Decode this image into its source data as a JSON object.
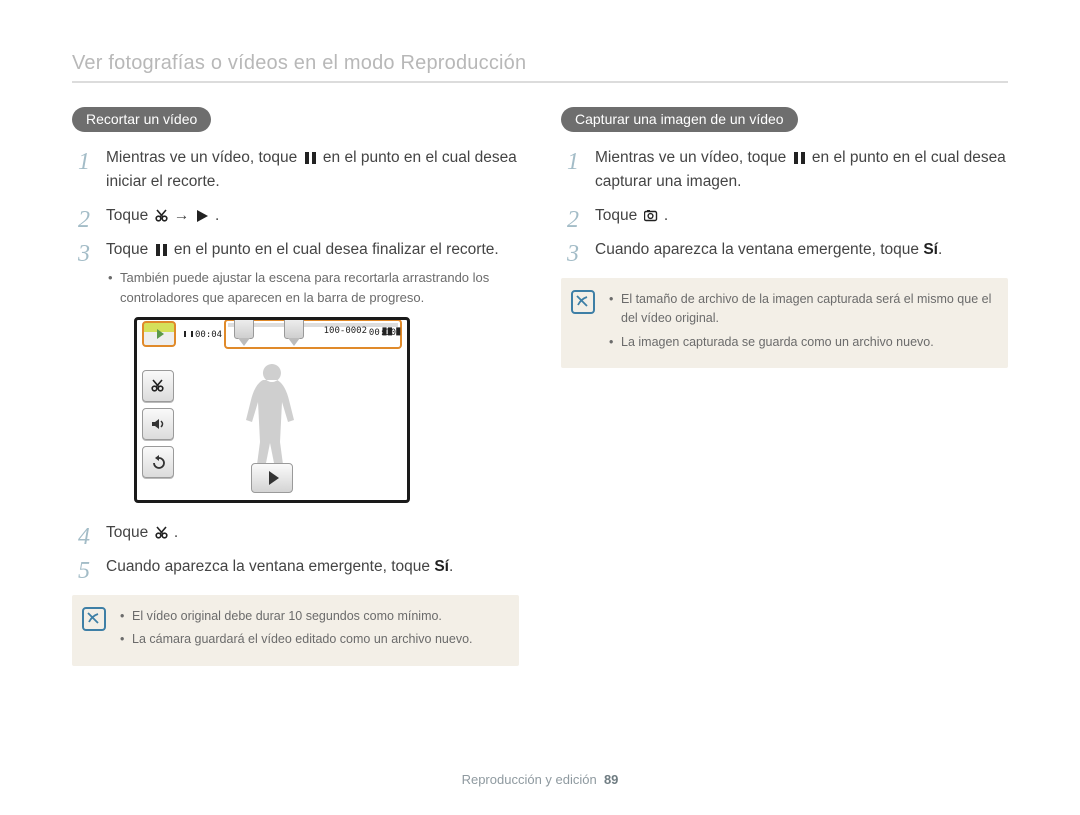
{
  "page_title": "Ver fotografías o vídeos en el modo Reproducción",
  "footer": {
    "section": "Reproducción y edición",
    "page": "89"
  },
  "left": {
    "heading": "Recortar un vídeo",
    "steps": [
      {
        "pre": "Mientras ve un vídeo, toque ",
        "icon": "pause",
        "post": " en el punto en el cual desea iniciar el recorte."
      },
      {
        "pre": "Toque ",
        "icon": "scissors",
        "mid": " → ",
        "icon2": "play",
        "post": "."
      },
      {
        "pre": "Toque ",
        "icon": "pause",
        "post": " en el punto en el cual desea finalizar el recorte.",
        "sub": "También puede ajustar la escena para recortarla arrastrando los controladores que aparecen en la barra de progreso."
      },
      {
        "pre": "Toque ",
        "icon": "scissors",
        "post": "."
      },
      {
        "pre": "Cuando aparezca la ventana emergente, toque ",
        "bold": "Sí",
        "post": "."
      }
    ],
    "note": [
      "El vídeo original debe durar 10 segundos como mínimo.",
      "La cámara guardará el vídeo editado como un archivo nuevo."
    ],
    "lcd": {
      "elapsed": "00:04",
      "total": "00:10",
      "file": "100-0002"
    }
  },
  "right": {
    "heading": "Capturar una imagen de un vídeo",
    "steps": [
      {
        "pre": "Mientras ve un vídeo, toque ",
        "icon": "pause",
        "post": " en el punto en el cual desea capturar una imagen."
      },
      {
        "pre": "Toque ",
        "icon": "capture",
        "post": "."
      },
      {
        "pre": "Cuando aparezca la ventana emergente, toque ",
        "bold": "Sí",
        "post": "."
      }
    ],
    "note": [
      "El tamaño de archivo de la imagen capturada será el mismo que el del vídeo original.",
      "La imagen capturada se guarda como un archivo nuevo."
    ]
  }
}
